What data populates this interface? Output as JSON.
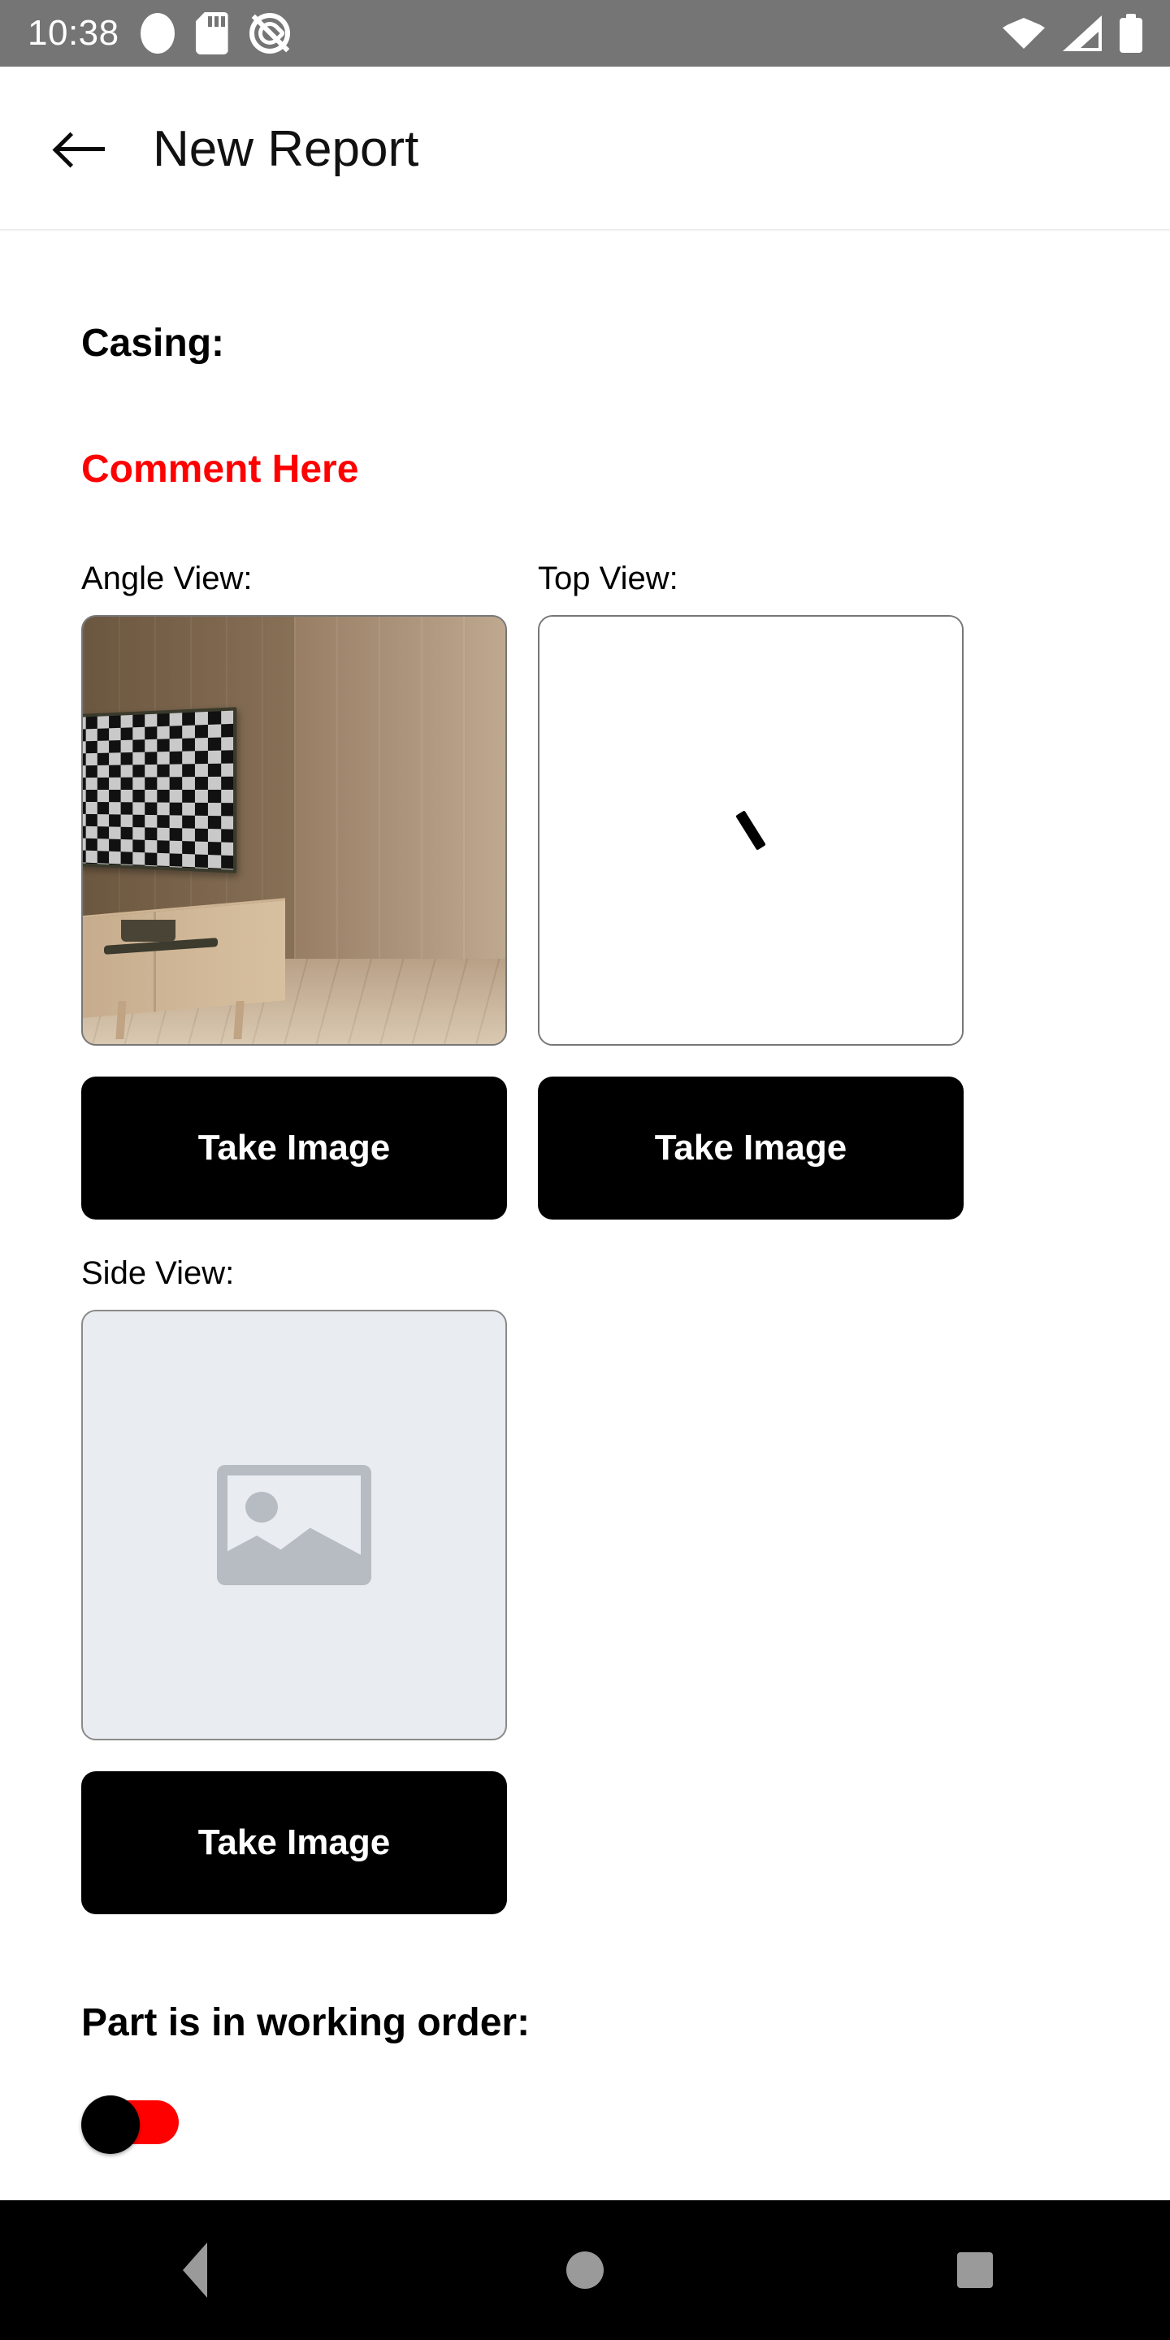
{
  "status_bar": {
    "time": "10:38",
    "left_icons": [
      "circle-indicator-icon",
      "sd-card-icon",
      "do-not-disturb-icon"
    ],
    "right_icons": [
      "wifi-icon",
      "cellular-signal-icon",
      "battery-icon"
    ],
    "background_color": "#757575"
  },
  "app_bar": {
    "back_icon": "back-arrow-icon",
    "title": "New Report"
  },
  "form": {
    "section_title": "Casing:",
    "comment": "Comment Here",
    "comment_color": "#FF0000",
    "views": [
      {
        "label": "Angle View:",
        "state": "captured",
        "button_label": "Take Image",
        "image_description": "Rendered room corner with wall-mounted style TV on wooden cabinet displaying black and white checkerboard test pattern with green marker strip"
      },
      {
        "label": "Top View:",
        "state": "captured",
        "button_label": "Take Image",
        "image_description": "Mostly white frame with a small black diagonal mark near the center"
      },
      {
        "label": "Side View:",
        "state": "empty",
        "button_label": "Take Image",
        "placeholder_icon": "image-placeholder-icon"
      }
    ],
    "working_order": {
      "label": "Part is in working order:",
      "toggle_state": "off",
      "toggle_track_color": "#FF0000",
      "toggle_thumb_color": "#000000"
    }
  },
  "nav_bar": {
    "buttons": [
      {
        "name": "back",
        "icon": "nav-back-triangle-icon"
      },
      {
        "name": "home",
        "icon": "nav-home-circle-icon"
      },
      {
        "name": "recents",
        "icon": "nav-recents-square-icon"
      }
    ],
    "background_color": "#000000"
  }
}
